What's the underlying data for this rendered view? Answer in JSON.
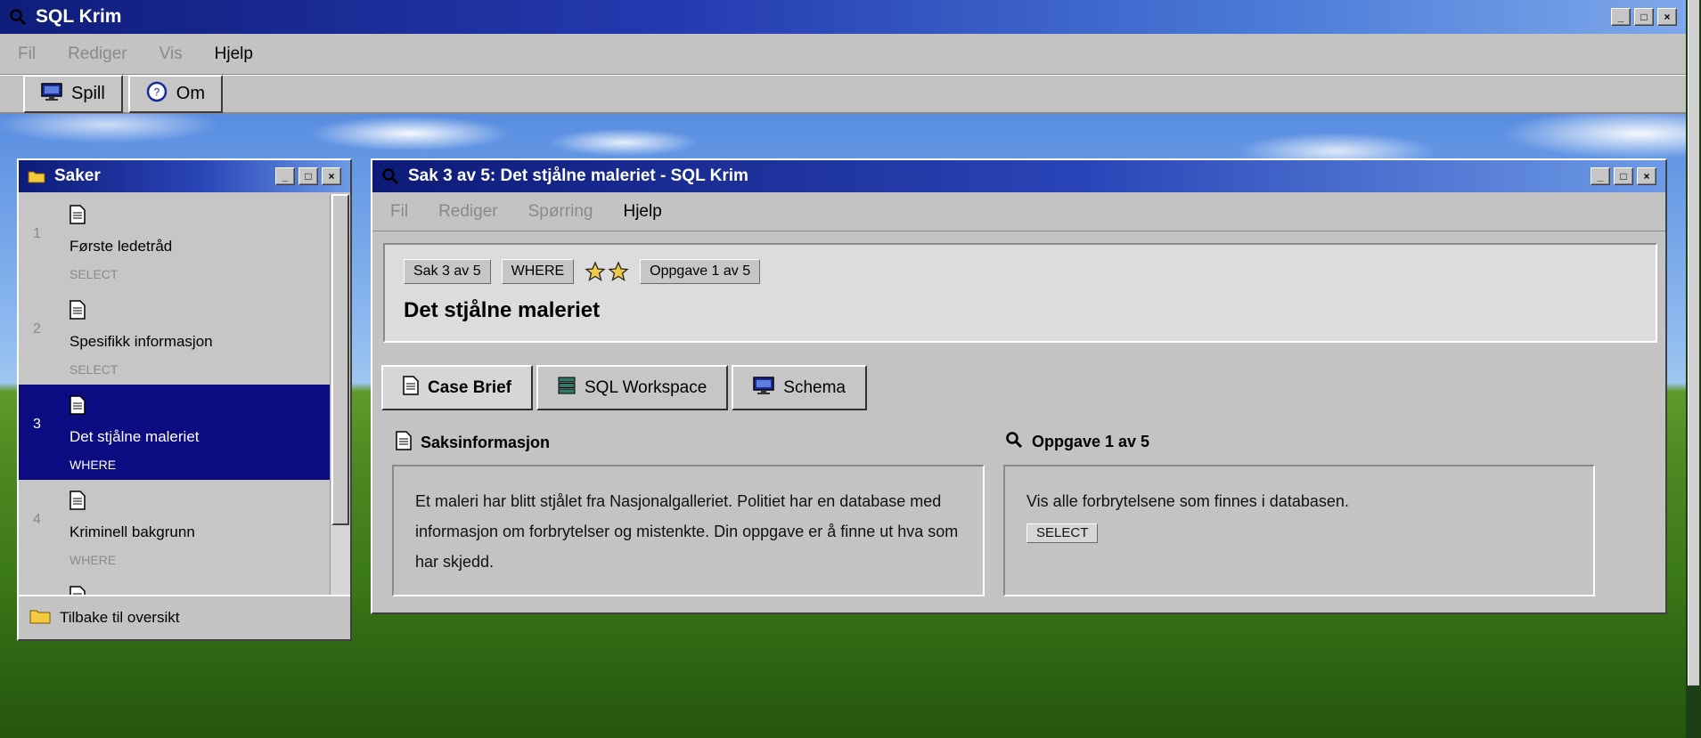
{
  "app": {
    "title": "SQL Krim",
    "menu": [
      "Fil",
      "Rediger",
      "Vis",
      "Hjelp"
    ],
    "toolbar": {
      "play_label": "Spill",
      "about_label": "Om"
    }
  },
  "saker": {
    "title": "Saker",
    "items": [
      {
        "number": "1",
        "name": "Første ledetråd",
        "tag": "SELECT"
      },
      {
        "number": "2",
        "name": "Spesifikk informasjon",
        "tag": "SELECT"
      },
      {
        "number": "3",
        "name": "Det stjålne maleriet",
        "tag": "WHERE",
        "selected": true
      },
      {
        "number": "4",
        "name": "Kriminell bakgrunn",
        "tag": "WHERE"
      }
    ],
    "back_label": "Tilbake til oversikt"
  },
  "sak": {
    "window_title": "Sak 3 av 5: Det stjålne maleriet - SQL Krim",
    "menu": [
      "Fil",
      "Rediger",
      "Spørring",
      "Hjelp"
    ],
    "badge_case": "Sak 3 av 5",
    "badge_topic": "WHERE",
    "stars": 2,
    "badge_task": "Oppgave 1 av 5",
    "title": "Det stjålne maleriet",
    "tabs": [
      "Case Brief",
      "SQL Workspace",
      "Schema"
    ],
    "info_heading": "Saksinformasjon",
    "info_text": "Et maleri har blitt stjålet fra Nasjonalgalleriet. Politiet har en database med informasjon om forbrytelser og mistenkte. Din oppgave er å finne ut hva som har skjedd.",
    "task_heading": "Oppgave 1 av 5",
    "task_text": "Vis alle forbrytelsene som finnes i databasen.",
    "task_tag": "SELECT"
  },
  "colors": {
    "titlebar": "#0d1a78",
    "selection": "#0b0b82",
    "chrome": "#c3c3c3",
    "star": "#f2c94c"
  },
  "icons": {
    "app": "magnifier-icon",
    "play": "monitor-icon",
    "about": "help-icon",
    "saker": "folder-icon",
    "case": "document-icon",
    "workspace": "database-icon",
    "schema": "monitor-icon"
  }
}
